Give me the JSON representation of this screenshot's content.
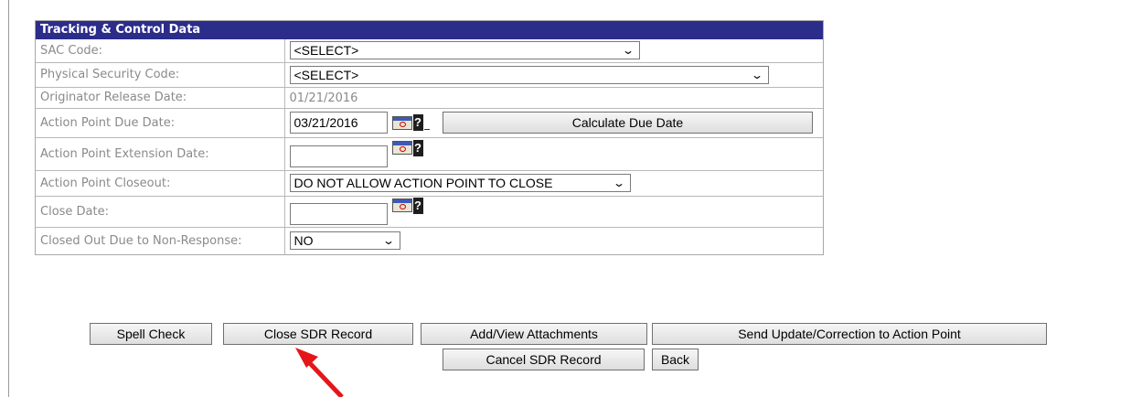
{
  "panel": {
    "title": "Tracking & Control Data",
    "rows": [
      {
        "label": "SAC Code:",
        "value": "<SELECT>"
      },
      {
        "label": "Physical Security Code:",
        "value": "<SELECT>"
      },
      {
        "label": "Originator Release Date:",
        "value": "01/21/2016"
      },
      {
        "label": "Action Point Due Date:",
        "value": "03/21/2016",
        "button": "Calculate Due Date"
      },
      {
        "label": "Action Point Extension Date:",
        "value": ""
      },
      {
        "label": "Action Point Closeout:",
        "value": "DO NOT ALLOW ACTION POINT TO CLOSE"
      },
      {
        "label": "Close Date:",
        "value": ""
      },
      {
        "label": "Closed Out Due to Non-Response:",
        "value": "NO"
      }
    ]
  },
  "icons": {
    "calendar": "calendar-icon",
    "help": "?",
    "chevron": "chevron-down-icon"
  },
  "actions": {
    "spell_check": "Spell Check",
    "close_record": "Close SDR Record",
    "attachments": "Add/View Attachments",
    "send_update": "Send Update/Correction to Action Point",
    "cancel_record": "Cancel SDR Record",
    "back": "Back"
  },
  "colors": {
    "header_bg": "#2c2c8a",
    "annotation_arrow": "#e5161a"
  }
}
